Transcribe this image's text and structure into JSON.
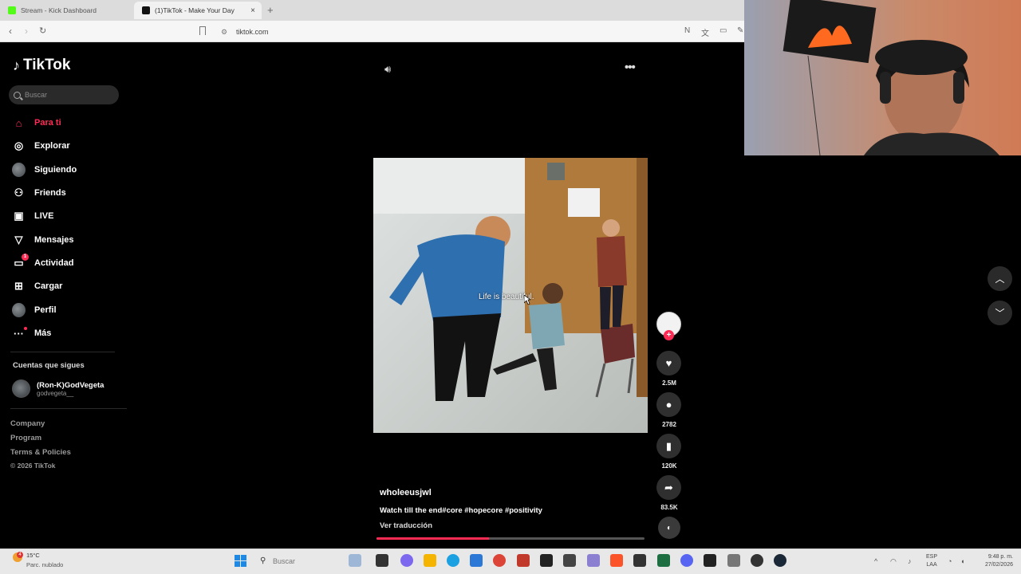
{
  "browser": {
    "tabs": [
      {
        "title": "Stream - Kick Dashboard",
        "active": false
      },
      {
        "title": "(1)TikTok - Make Your Day",
        "active": true
      }
    ],
    "new_tab": "+",
    "close": "×",
    "url": "tiktok.com"
  },
  "sidebar": {
    "logo": "TikTok",
    "search_placeholder": "Buscar",
    "items": [
      {
        "label": "Para ti",
        "icon": "home-icon",
        "active": true
      },
      {
        "label": "Explorar",
        "icon": "compass-icon"
      },
      {
        "label": "Siguiendo",
        "icon": "avatar-icon"
      },
      {
        "label": "Friends",
        "icon": "friends-icon"
      },
      {
        "label": "LIVE",
        "icon": "live-icon"
      },
      {
        "label": "Mensajes",
        "icon": "messages-icon"
      },
      {
        "label": "Actividad",
        "icon": "activity-icon",
        "badge": "1"
      },
      {
        "label": "Cargar",
        "icon": "upload-icon"
      },
      {
        "label": "Perfil",
        "icon": "profile-avatar-icon"
      },
      {
        "label": "Más",
        "icon": "more-icon"
      }
    ],
    "following_header": "Cuentas que sigues",
    "following": [
      {
        "name": "(Ron-K)GodVegeta",
        "handle": "godvegeta__"
      }
    ],
    "footer_links": [
      "Company",
      "Program",
      "Terms & Policies"
    ],
    "copyright": "© 2026 TikTok"
  },
  "video": {
    "overlay_caption": "Life is beautiful.",
    "author": "wholeeusjwl",
    "description": "Watch till the end#core #hopecore #positivity",
    "translate_label": "Ver traducción",
    "progress": 0.42
  },
  "actions": {
    "likes": "2.5M",
    "comments": "2782",
    "saves": "120K",
    "shares": "83.5K"
  },
  "taskbar": {
    "weather_temp": "15°C",
    "weather_cond": "Parc. nublado",
    "weather_badge": "4",
    "search": "Buscar",
    "lang_top": "ESP",
    "lang_bottom": "LAA",
    "time": "9:48 p. m.",
    "date": "27/02/2026"
  },
  "colors": {
    "accent": "#fe2c55",
    "background": "#000000"
  }
}
